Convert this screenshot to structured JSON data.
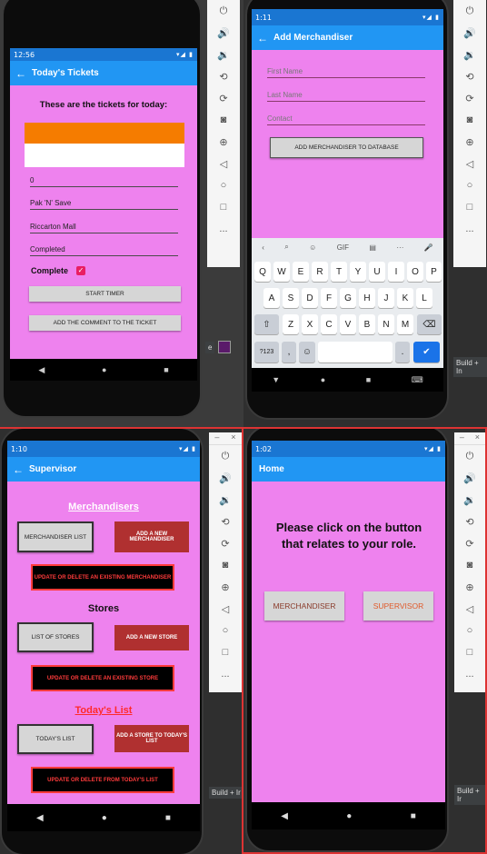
{
  "emulator_tools": {
    "top_minimize": "–",
    "top_close": "×",
    "ellipsis": "..."
  },
  "ide": {
    "build_label": "Build + In",
    "build_label_q3": "Build + Ir",
    "build_label_q4": "Build + Ir",
    "small_label": "e"
  },
  "q1": {
    "status_time": "12:56",
    "status_right": "▾◢ ▮",
    "title": "Today's Tickets",
    "heading": "These are the tickets for today:",
    "list_item_selected": "",
    "fields": [
      "0",
      "Pak 'N' Save",
      "Riccarton Mall",
      "Completed"
    ],
    "complete_label": "Complete",
    "start_timer": "START TIMER",
    "add_comment": "ADD THE COMMENT TO THE TICKET"
  },
  "q2": {
    "status_time": "1:11",
    "status_right": "▾◢ ▮",
    "title": "Add Merchandiser",
    "placeholders": {
      "first": "First Name",
      "last": "Last Name",
      "contact": "Contact"
    },
    "button": "ADD MERCHANDISER TO DATABASE",
    "kb_top": [
      "‹",
      "⌕",
      "☺",
      "GIF",
      "▤",
      "···",
      "🎤"
    ],
    "row1": [
      "Q",
      "W",
      "E",
      "R",
      "T",
      "Y",
      "U",
      "I",
      "O",
      "P"
    ],
    "row1_nums": [
      "1",
      "2",
      "3",
      "4",
      "5",
      "6",
      "7",
      "8",
      "9",
      "0"
    ],
    "row2": [
      "A",
      "S",
      "D",
      "F",
      "G",
      "H",
      "J",
      "K",
      "L"
    ],
    "row3": [
      "Z",
      "X",
      "C",
      "V",
      "B",
      "N",
      "M"
    ],
    "sym": "?123",
    "comma": ",",
    "period": "."
  },
  "q3": {
    "status_time": "1:10",
    "status_right": "▾◢ ▮",
    "title": "Supervisor",
    "merch_heading": "Merchandisers",
    "merch_list": "MERCHANDISER LIST",
    "add_merch": "ADD A NEW MERCHANDISER",
    "update_merch": "UPDATE OR DELETE AN EXISTING MERCHANDISER",
    "stores_heading": "Stores",
    "list_stores": "LIST OF STORES",
    "add_store": "ADD A NEW STORE",
    "update_store": "UPDATE OR DELETE AN EXISTING STORE",
    "today_heading": "Today's List",
    "todays_list": "TODAY'S LIST",
    "add_store_today": "ADD A STORE TO TODAY'S LIST",
    "update_today": "UPDATE OR DELETE FROM TODAY'S LIST"
  },
  "q4": {
    "status_time": "1:02",
    "status_right": "▾◢ ▮",
    "title": "Home",
    "prompt": "Please click on the button that relates to your role.",
    "merchandiser": "MERCHANDISER",
    "supervisor": "SUPERVISOR"
  },
  "colors": {
    "screen_bg": "#ee82ee",
    "appbar": "#2196f3",
    "statusbar": "#1a76d2",
    "orange": "#f57c00",
    "red_button": "#b03030"
  }
}
